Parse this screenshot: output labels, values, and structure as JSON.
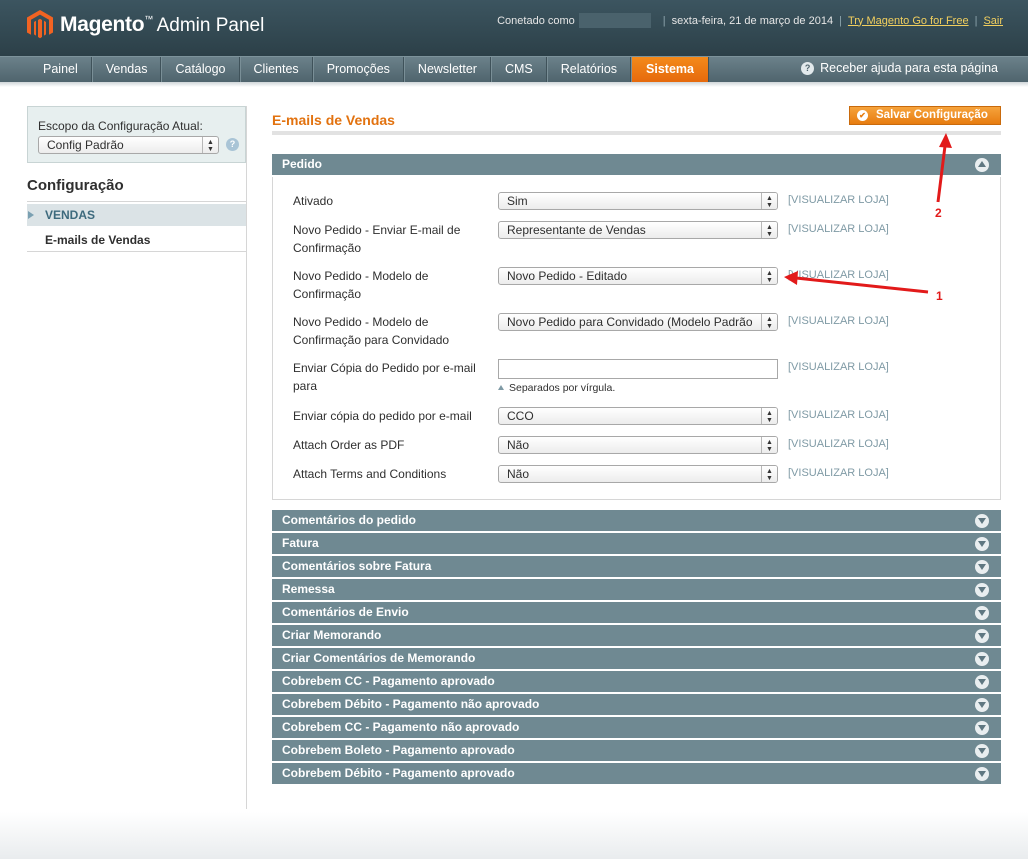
{
  "header": {
    "logo_brand": "Magento",
    "logo_tm": "™",
    "logo_sub": "Admin Panel",
    "connected_label": "Conetado como",
    "date": "sexta-feira, 21 de março de 2014",
    "try_link": "Try Magento Go for Free",
    "logout": "Sair"
  },
  "nav": {
    "items": [
      "Painel",
      "Vendas",
      "Catálogo",
      "Clientes",
      "Promoções",
      "Newsletter",
      "CMS",
      "Relatórios",
      "Sistema"
    ],
    "active_index": 8,
    "help": "Receber ajuda para esta página"
  },
  "sidebar": {
    "scope_label": "Escopo da Configuração Atual:",
    "scope_value": "Config Padrão",
    "title": "Configuração",
    "section": "VENDAS",
    "link": "E-mails de Vendas"
  },
  "main": {
    "title": "E-mails de Vendas",
    "save_button": "Salvar Configuração",
    "fieldset_title": "Pedido",
    "scope_tag": "[VISUALIZAR LOJA]",
    "fields": [
      {
        "label": "Ativado",
        "value": "Sim"
      },
      {
        "label": "Novo Pedido - Enviar E-mail de Confirmação",
        "value": "Representante de Vendas"
      },
      {
        "label": "Novo Pedido - Modelo de Confirmação",
        "value": "Novo Pedido - Editado"
      },
      {
        "label": "Novo Pedido - Modelo de Confirmação para Convidado",
        "value": "Novo Pedido para Convidado (Modelo Padrão"
      },
      {
        "label": "Enviar Cópia do Pedido por e-mail para",
        "value": "",
        "note": "Separados por vírgula."
      },
      {
        "label": "Enviar cópia do pedido por e-mail",
        "value": "CCO"
      },
      {
        "label": "Attach Order as PDF",
        "value": "Não"
      },
      {
        "label": "Attach Terms and Conditions",
        "value": "Não"
      }
    ],
    "collapsed_sections": [
      "Comentários do pedido",
      "Fatura",
      "Comentários sobre Fatura",
      "Remessa",
      "Comentários de Envio",
      "Criar Memorando",
      "Criar Comentários de Memorando",
      "Cobrebem CC - Pagamento aprovado",
      "Cobrebem Débito - Pagamento não aprovado",
      "Cobrebem CC - Pagamento não aprovado",
      "Cobrebem Boleto - Pagamento aprovado",
      "Cobrebem Débito - Pagamento aprovado"
    ]
  },
  "annotations": {
    "label_1": "1",
    "label_2": "2",
    "color": "#e21a1a"
  },
  "colors": {
    "accent_orange": "#e2720f",
    "header_bg": "#2c4048",
    "section_bar": "#6f8992"
  }
}
